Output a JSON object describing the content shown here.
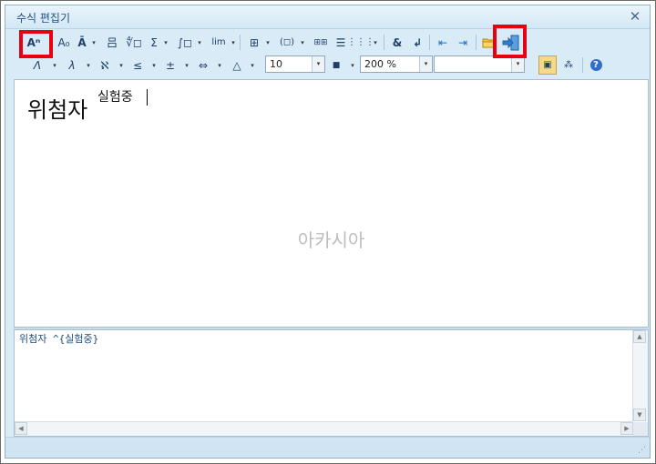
{
  "window": {
    "title": "수식 편집기",
    "close_glyph": "✕"
  },
  "toolbar1": {
    "format": "Aⁿ",
    "sub": "A₀",
    "accent": "Ā",
    "fraction": "吕",
    "root": "∜◻",
    "sum": "Σ",
    "integral": "∫◻",
    "limit": "lim",
    "matrix_op": "⊞",
    "bracket": "(◻)",
    "matrix": "⊞⊞",
    "lines": "☰",
    "grid": "⋮⋮⋮",
    "amp": "&",
    "newline": "↲",
    "prev": "⇤",
    "next": "⇥",
    "open_icon": "folder-open-icon",
    "insert_icon": "insert-exit-icon",
    "dropdown": "▾"
  },
  "toolbar2": {
    "greek_upper": "Λ",
    "greek_lower": "λ",
    "symbol": "ℵ",
    "relation": "≤",
    "operator": "±",
    "arrow": "⇔",
    "misc": "△",
    "font_size": "10",
    "color_glyph": "■",
    "zoom": "200 %",
    "font": "",
    "toggle": "▣",
    "layout": "⁂",
    "help": "?",
    "dropdown": "▾"
  },
  "editor": {
    "base": "위첨자",
    "superscript": "실험중",
    "watermark": "아카시아"
  },
  "source": {
    "text": "위첨자 ^{실험중}"
  },
  "scroll": {
    "up": "▲",
    "down": "▼",
    "left": "◀",
    "right": "▶"
  },
  "status": {
    "grip": "⋰"
  }
}
